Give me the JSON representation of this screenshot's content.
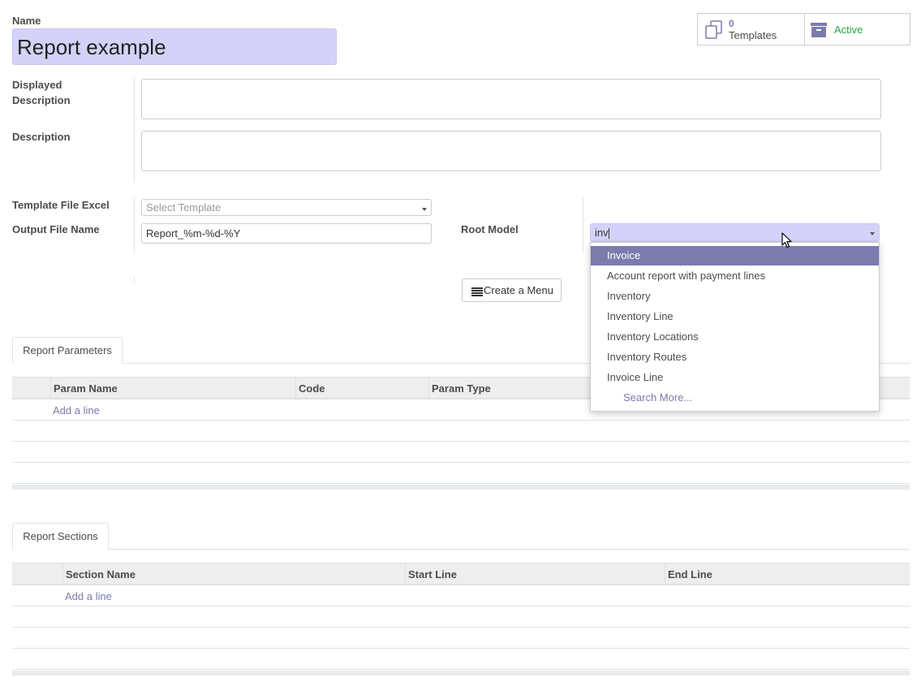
{
  "form": {
    "name_label": "Name",
    "name_value": "Report example",
    "displayed_description_label_1": "Displayed",
    "displayed_description_label_2": "Description",
    "description_label": "Description",
    "template_file_label": "Template File Excel",
    "template_file_placeholder": "Select Template",
    "output_file_label": "Output File Name",
    "output_file_value": "Report_%m-%d-%Y",
    "root_model_label": "Root Model",
    "root_model_value": "inv",
    "create_menu_label": "Create a Menu"
  },
  "smart_buttons": {
    "templates_count": "0",
    "templates_label": "Templates",
    "active_label": "Active"
  },
  "dropdown": {
    "items": [
      "Invoice",
      "Account report with payment lines",
      "Inventory",
      "Inventory Line",
      "Inventory Locations",
      "Inventory Routes",
      "Invoice Line"
    ],
    "search_more": "Search More..."
  },
  "params_section": {
    "tab_label": "Report Parameters",
    "columns": [
      "Param Name",
      "Code",
      "Param Type"
    ],
    "add_line": "Add a line"
  },
  "sections_section": {
    "tab_label": "Report Sections",
    "columns": [
      "Section Name",
      "Start Line",
      "End Line"
    ],
    "add_line": "Add a line"
  },
  "colors": {
    "accent": "#7c7bad",
    "name_highlight": "#d4d2f8",
    "active_green": "#28a745"
  }
}
